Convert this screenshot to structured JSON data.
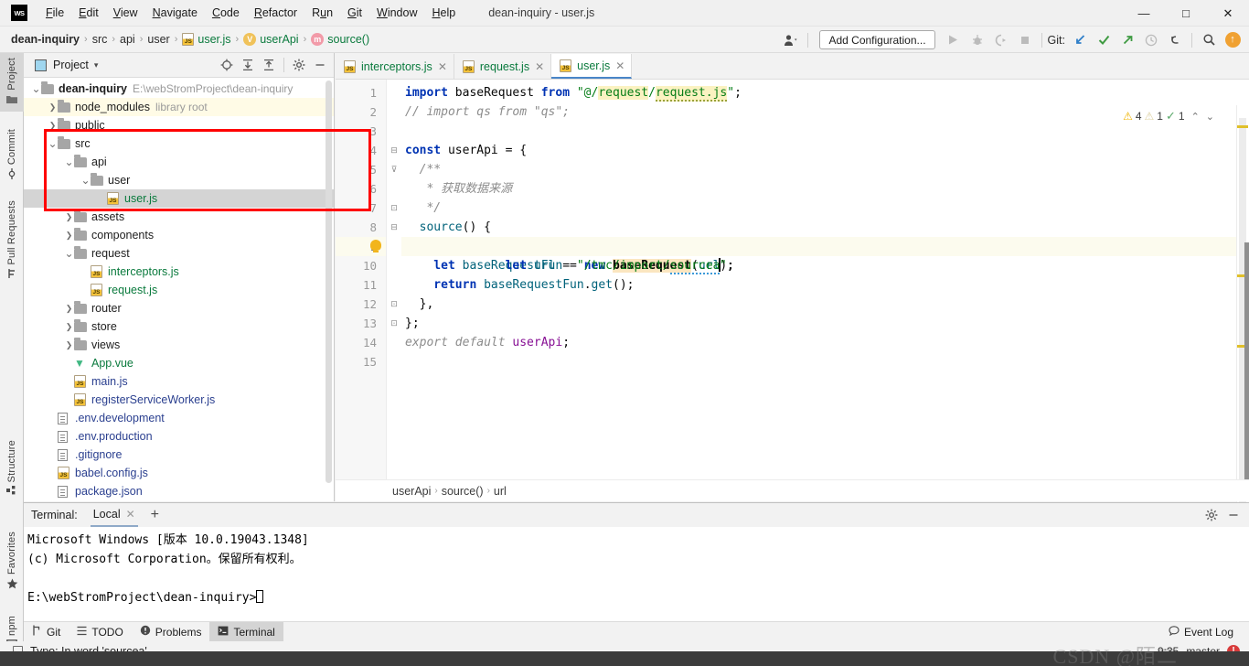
{
  "window": {
    "title": "dean-inquiry - user.js",
    "logo_text": "WS",
    "minimize": "—",
    "maximize": "□",
    "close": "✕"
  },
  "menubar": {
    "items": [
      {
        "label": "File",
        "mnemonic": "F"
      },
      {
        "label": "Edit",
        "mnemonic": "E"
      },
      {
        "label": "View",
        "mnemonic": "V"
      },
      {
        "label": "Navigate",
        "mnemonic": "N"
      },
      {
        "label": "Code",
        "mnemonic": "C"
      },
      {
        "label": "Refactor",
        "mnemonic": "R"
      },
      {
        "label": "Run",
        "mnemonic": "u"
      },
      {
        "label": "Git",
        "mnemonic": "G"
      },
      {
        "label": "Window",
        "mnemonic": "W"
      },
      {
        "label": "Help",
        "mnemonic": "H"
      }
    ]
  },
  "breadcrumb": {
    "items": [
      {
        "label": "dean-inquiry",
        "icon": null,
        "style": "bold"
      },
      {
        "label": "src",
        "icon": null,
        "style": "normal"
      },
      {
        "label": "api",
        "icon": null,
        "style": "normal"
      },
      {
        "label": "user",
        "icon": null,
        "style": "normal"
      },
      {
        "label": "user.js",
        "icon": "js-file-icon",
        "style": "green"
      },
      {
        "label": "userApi",
        "icon": "variable-badge",
        "badge": "V",
        "badge_color": "#f0c25a",
        "style": "green"
      },
      {
        "label": "source()",
        "icon": "method-badge",
        "badge": "m",
        "badge_color": "#f29aa8",
        "style": "green"
      }
    ],
    "separator": "›"
  },
  "toolbar": {
    "user_icon": "user-avatar-icon",
    "add_configuration": "Add Configuration...",
    "run_icon": "run-play-icon",
    "debug_icon": "debug-bug-icon",
    "coverage_icon": "run-coverage-icon",
    "stop_icon": "stop-square-icon",
    "git_label": "Git:",
    "update_icon": "git-update-arrow-icon",
    "commit_icon": "git-commit-check-icon",
    "push_icon": "git-push-arrow-icon",
    "history_icon": "history-clock-icon",
    "undo_icon": "undo-arrow-icon",
    "search_icon": "search-magnifier-icon",
    "notify_icon": "update-circle-icon"
  },
  "left_stripe": {
    "tabs": [
      {
        "label": "Project",
        "icon": "project-folder-icon",
        "active": true
      },
      {
        "label": "Commit",
        "icon": "commit-node-icon",
        "active": false
      },
      {
        "label": "Pull Requests",
        "icon": "pull-request-icon",
        "active": false
      },
      {
        "label": "Structure",
        "icon": "structure-blocks-icon",
        "active": false
      },
      {
        "label": "Favorites",
        "icon": "favorites-star-icon",
        "active": false
      },
      {
        "label": "npm",
        "icon": "npm-box-icon",
        "active": false
      }
    ]
  },
  "project_panel": {
    "title": "Project",
    "caret": "▾",
    "actions": [
      {
        "name": "scroll-from-source-icon",
        "glyph": "⊕"
      },
      {
        "name": "expand-all-icon",
        "glyph": "⤓"
      },
      {
        "name": "collapse-all-icon",
        "glyph": "⤒"
      },
      {
        "name": "settings-gear-icon",
        "glyph": "✿"
      },
      {
        "name": "hide-panel-icon",
        "glyph": "—"
      }
    ],
    "tree": [
      {
        "indent": 0,
        "arrow": "v",
        "icon": "folder",
        "label": "dean-inquiry",
        "style": "bold",
        "sub": "E:\\webStromProject\\dean-inquiry"
      },
      {
        "indent": 1,
        "arrow": ">",
        "icon": "folder",
        "label": "node_modules",
        "style": "normal",
        "sub": "library root",
        "rowhl": "yellow"
      },
      {
        "indent": 1,
        "arrow": ">",
        "icon": "folder",
        "label": "public",
        "style": "normal",
        "sub": ""
      },
      {
        "indent": 1,
        "arrow": "v",
        "icon": "folder",
        "label": "src",
        "style": "normal",
        "sub": ""
      },
      {
        "indent": 2,
        "arrow": "v",
        "icon": "folder",
        "label": "api",
        "style": "normal",
        "sub": ""
      },
      {
        "indent": 3,
        "arrow": "v",
        "icon": "folder",
        "label": "user",
        "style": "normal",
        "sub": ""
      },
      {
        "indent": 4,
        "arrow": "",
        "icon": "js",
        "label": "user.js",
        "style": "green",
        "sub": "",
        "selected": true
      },
      {
        "indent": 2,
        "arrow": ">",
        "icon": "folder",
        "label": "assets",
        "style": "normal",
        "sub": ""
      },
      {
        "indent": 2,
        "arrow": ">",
        "icon": "folder",
        "label": "components",
        "style": "normal",
        "sub": ""
      },
      {
        "indent": 2,
        "arrow": "v",
        "icon": "folder",
        "label": "request",
        "style": "normal",
        "sub": ""
      },
      {
        "indent": 3,
        "arrow": "",
        "icon": "js",
        "label": "interceptors.js",
        "style": "green",
        "sub": ""
      },
      {
        "indent": 3,
        "arrow": "",
        "icon": "js",
        "label": "request.js",
        "style": "green",
        "sub": ""
      },
      {
        "indent": 2,
        "arrow": ">",
        "icon": "folder",
        "label": "router",
        "style": "normal",
        "sub": ""
      },
      {
        "indent": 2,
        "arrow": ">",
        "icon": "folder",
        "label": "store",
        "style": "normal",
        "sub": ""
      },
      {
        "indent": 2,
        "arrow": ">",
        "icon": "folder",
        "label": "views",
        "style": "normal",
        "sub": ""
      },
      {
        "indent": 2,
        "arrow": "",
        "icon": "vue",
        "label": "App.vue",
        "style": "green",
        "sub": ""
      },
      {
        "indent": 2,
        "arrow": "",
        "icon": "js",
        "label": "main.js",
        "style": "blue",
        "sub": ""
      },
      {
        "indent": 2,
        "arrow": "",
        "icon": "js",
        "label": "registerServiceWorker.js",
        "style": "blue",
        "sub": ""
      },
      {
        "indent": 1,
        "arrow": "",
        "icon": "doc",
        "label": ".env.development",
        "style": "blue",
        "sub": ""
      },
      {
        "indent": 1,
        "arrow": "",
        "icon": "doc",
        "label": ".env.production",
        "style": "blue",
        "sub": ""
      },
      {
        "indent": 1,
        "arrow": "",
        "icon": "gitignore",
        "label": ".gitignore",
        "style": "blue",
        "sub": ""
      },
      {
        "indent": 1,
        "arrow": "",
        "icon": "js",
        "label": "babel.config.js",
        "style": "blue",
        "sub": ""
      },
      {
        "indent": 1,
        "arrow": "",
        "icon": "json",
        "label": "package.json",
        "style": "blue",
        "sub": ""
      }
    ]
  },
  "annotation": {
    "type": "red-rectangle",
    "color": "#ff0000",
    "covers": "src > api > user > user.js"
  },
  "editor": {
    "tabs": [
      {
        "label": "interceptors.js",
        "icon": "js-file-icon",
        "active": false,
        "close": "✕"
      },
      {
        "label": "request.js",
        "icon": "js-file-icon",
        "active": false,
        "close": "✕"
      },
      {
        "label": "user.js",
        "icon": "js-file-icon",
        "active": true,
        "close": "✕"
      }
    ],
    "line_numbers": [
      "1",
      "2",
      "3",
      "4",
      "5",
      "6",
      "7",
      "8",
      "9",
      "10",
      "11",
      "12",
      "13",
      "14",
      "15"
    ],
    "current_line": 9,
    "code_lines": [
      "import baseRequest from \"@/request/request.js\";",
      "// import qs from \"qs\";",
      "",
      "const userApi = {",
      "  /**",
      "   * 获取数据来源",
      "   */",
      "  source() {",
      "    let url = \"/tmc/import/sourcea\";",
      "    let baseRequestFun = new baseRequest(url);",
      "    return baseRequestFun.get();",
      "  },",
      "};",
      "export default userApi;",
      ""
    ],
    "inspections": {
      "warning_count": "4",
      "weak_warning_count": "1",
      "ok_count": "1",
      "up_arrow": "⌃",
      "down_arrow": "⌄"
    },
    "bottom_crumbs": [
      "userApi",
      "source()",
      "url"
    ],
    "bottom_crumb_sep": "›"
  },
  "terminal": {
    "label": "Terminal:",
    "tab": "Local",
    "tab_close": "✕",
    "add": "+",
    "settings_icon": "gear-icon",
    "hide_icon": "minimize-icon",
    "lines": [
      "Microsoft Windows [版本 10.0.19043.1348]",
      "(c) Microsoft Corporation。保留所有权利。",
      "",
      "E:\\webStromProject\\dean-inquiry>"
    ]
  },
  "statusbar": {
    "items": [
      {
        "label": "Git",
        "icon": "git-branch-icon",
        "active": false
      },
      {
        "label": "TODO",
        "icon": "todo-list-icon",
        "active": false
      },
      {
        "label": "Problems",
        "icon": "problems-exclaim-icon",
        "active": false
      },
      {
        "label": "Terminal",
        "icon": "terminal-prompt-icon",
        "active": true
      }
    ],
    "event_log": "Event Log",
    "event_log_icon": "event-log-balloon-icon"
  },
  "hintbar": {
    "icon": "inspection-box-icon",
    "text": "Typo: In word 'sourcea'",
    "time": "9:35",
    "branch": "master",
    "error_badge": "!"
  },
  "watermark": "CSDN @陌二"
}
